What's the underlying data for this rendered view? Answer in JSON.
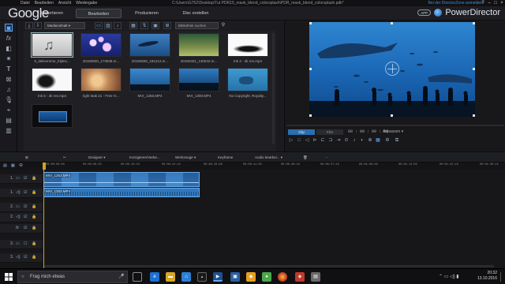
{
  "titlebar": {
    "menu": [
      "Datei",
      "Bearbeiten",
      "Ansicht",
      "Wiedergabe"
    ],
    "path": "C:\\Users\\G752\\Desktop\\Tut PDR15_mask_blend_colorsplash\\PDR_mask_blend_colorsplash.pdk*",
    "login": "Bei der DirectorZone anmelden",
    "controls": [
      "?",
      "–",
      "□",
      "×"
    ]
  },
  "overlay": {
    "google_text": "Google"
  },
  "tabs": {
    "items": [
      "Importieren",
      "Bearbeiten",
      "Produzieren",
      "Disc erstellen"
    ],
    "active": "Bearbeiten"
  },
  "brand": {
    "badge": "APP",
    "name": "PowerDirector"
  },
  "library": {
    "dropdown": "Medieninhalt",
    "search_placeholder": "Bibliothek suchen",
    "clips": [
      {
        "caption": "9_delivernme_triplex..."
      },
      {
        "caption": "20160830_173638.m..."
      },
      {
        "caption": "20160830_181212.m..."
      },
      {
        "caption": "20160401_130042.m..."
      },
      {
        "caption": "Ink 4 - 4k res.mp4"
      },
      {
        "caption": "Ink 6 - 4k res.mp4"
      },
      {
        "caption": "light leak 21 - Free H..."
      },
      {
        "caption": "MVI_1256.MP4"
      },
      {
        "caption": "MVI_1300.MP4"
      },
      {
        "caption": "No Copyright, Royalty..."
      },
      {
        "caption": ""
      }
    ]
  },
  "preview": {
    "clip_label": "Clip",
    "film_label": "Film",
    "timecode": "00 : 00 : 00 : 00",
    "fit_label": "Anpassen"
  },
  "timeline_toolbar": {
    "designer": "Designer",
    "fix_enhance": "Korrigieren/Verbe...",
    "tools": "Werkzeuge",
    "keyframe": "Keyframe",
    "audio_edit": "Audio bearbei..."
  },
  "ruler": {
    "labels": [
      "00:00:00:00",
      "00:00:08:05",
      "00:00:16:10",
      "00:00:24:15",
      "00:00:33:00",
      "00:00:41:05",
      "00:00:49:10",
      "00:00:57:15",
      "00:01:06:00",
      "00:01:14:05",
      "00:01:22:10",
      "00:01:30:15"
    ]
  },
  "tracks": {
    "rows": [
      {
        "label": "1.",
        "kind": "video"
      },
      {
        "label": "1.",
        "kind": "audio"
      },
      {
        "label": "2.",
        "kind": "video"
      },
      {
        "label": "2.",
        "kind": "audio"
      },
      {
        "label": "fx",
        "kind": "effect"
      },
      {
        "label": "3.",
        "kind": "video"
      },
      {
        "label": "3.",
        "kind": "audio"
      }
    ],
    "video_clip_label": "MVI_1253.MP4",
    "audio_clip_label": "MVI_1253.MP4"
  },
  "taskbar": {
    "search_placeholder": "Frag mich etwas",
    "time": "20:32",
    "date": "13.10.2016"
  },
  "colors": {
    "accent_blue": "#3b8fd8",
    "playhead": "#d6a020",
    "clip_blue": "#3f85c9"
  }
}
